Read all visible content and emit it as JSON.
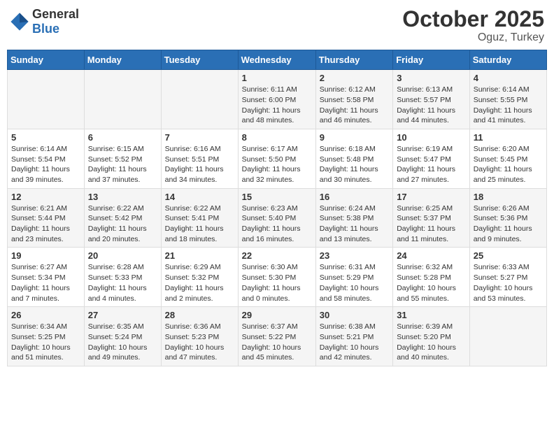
{
  "header": {
    "logo_general": "General",
    "logo_blue": "Blue",
    "month": "October 2025",
    "location": "Oguz, Turkey"
  },
  "days_of_week": [
    "Sunday",
    "Monday",
    "Tuesday",
    "Wednesday",
    "Thursday",
    "Friday",
    "Saturday"
  ],
  "weeks": [
    [
      {
        "day": "",
        "info": ""
      },
      {
        "day": "",
        "info": ""
      },
      {
        "day": "",
        "info": ""
      },
      {
        "day": "1",
        "info": "Sunrise: 6:11 AM\nSunset: 6:00 PM\nDaylight: 11 hours and 48 minutes."
      },
      {
        "day": "2",
        "info": "Sunrise: 6:12 AM\nSunset: 5:58 PM\nDaylight: 11 hours and 46 minutes."
      },
      {
        "day": "3",
        "info": "Sunrise: 6:13 AM\nSunset: 5:57 PM\nDaylight: 11 hours and 44 minutes."
      },
      {
        "day": "4",
        "info": "Sunrise: 6:14 AM\nSunset: 5:55 PM\nDaylight: 11 hours and 41 minutes."
      }
    ],
    [
      {
        "day": "5",
        "info": "Sunrise: 6:14 AM\nSunset: 5:54 PM\nDaylight: 11 hours and 39 minutes."
      },
      {
        "day": "6",
        "info": "Sunrise: 6:15 AM\nSunset: 5:52 PM\nDaylight: 11 hours and 37 minutes."
      },
      {
        "day": "7",
        "info": "Sunrise: 6:16 AM\nSunset: 5:51 PM\nDaylight: 11 hours and 34 minutes."
      },
      {
        "day": "8",
        "info": "Sunrise: 6:17 AM\nSunset: 5:50 PM\nDaylight: 11 hours and 32 minutes."
      },
      {
        "day": "9",
        "info": "Sunrise: 6:18 AM\nSunset: 5:48 PM\nDaylight: 11 hours and 30 minutes."
      },
      {
        "day": "10",
        "info": "Sunrise: 6:19 AM\nSunset: 5:47 PM\nDaylight: 11 hours and 27 minutes."
      },
      {
        "day": "11",
        "info": "Sunrise: 6:20 AM\nSunset: 5:45 PM\nDaylight: 11 hours and 25 minutes."
      }
    ],
    [
      {
        "day": "12",
        "info": "Sunrise: 6:21 AM\nSunset: 5:44 PM\nDaylight: 11 hours and 23 minutes."
      },
      {
        "day": "13",
        "info": "Sunrise: 6:22 AM\nSunset: 5:42 PM\nDaylight: 11 hours and 20 minutes."
      },
      {
        "day": "14",
        "info": "Sunrise: 6:22 AM\nSunset: 5:41 PM\nDaylight: 11 hours and 18 minutes."
      },
      {
        "day": "15",
        "info": "Sunrise: 6:23 AM\nSunset: 5:40 PM\nDaylight: 11 hours and 16 minutes."
      },
      {
        "day": "16",
        "info": "Sunrise: 6:24 AM\nSunset: 5:38 PM\nDaylight: 11 hours and 13 minutes."
      },
      {
        "day": "17",
        "info": "Sunrise: 6:25 AM\nSunset: 5:37 PM\nDaylight: 11 hours and 11 minutes."
      },
      {
        "day": "18",
        "info": "Sunrise: 6:26 AM\nSunset: 5:36 PM\nDaylight: 11 hours and 9 minutes."
      }
    ],
    [
      {
        "day": "19",
        "info": "Sunrise: 6:27 AM\nSunset: 5:34 PM\nDaylight: 11 hours and 7 minutes."
      },
      {
        "day": "20",
        "info": "Sunrise: 6:28 AM\nSunset: 5:33 PM\nDaylight: 11 hours and 4 minutes."
      },
      {
        "day": "21",
        "info": "Sunrise: 6:29 AM\nSunset: 5:32 PM\nDaylight: 11 hours and 2 minutes."
      },
      {
        "day": "22",
        "info": "Sunrise: 6:30 AM\nSunset: 5:30 PM\nDaylight: 11 hours and 0 minutes."
      },
      {
        "day": "23",
        "info": "Sunrise: 6:31 AM\nSunset: 5:29 PM\nDaylight: 10 hours and 58 minutes."
      },
      {
        "day": "24",
        "info": "Sunrise: 6:32 AM\nSunset: 5:28 PM\nDaylight: 10 hours and 55 minutes."
      },
      {
        "day": "25",
        "info": "Sunrise: 6:33 AM\nSunset: 5:27 PM\nDaylight: 10 hours and 53 minutes."
      }
    ],
    [
      {
        "day": "26",
        "info": "Sunrise: 6:34 AM\nSunset: 5:25 PM\nDaylight: 10 hours and 51 minutes."
      },
      {
        "day": "27",
        "info": "Sunrise: 6:35 AM\nSunset: 5:24 PM\nDaylight: 10 hours and 49 minutes."
      },
      {
        "day": "28",
        "info": "Sunrise: 6:36 AM\nSunset: 5:23 PM\nDaylight: 10 hours and 47 minutes."
      },
      {
        "day": "29",
        "info": "Sunrise: 6:37 AM\nSunset: 5:22 PM\nDaylight: 10 hours and 45 minutes."
      },
      {
        "day": "30",
        "info": "Sunrise: 6:38 AM\nSunset: 5:21 PM\nDaylight: 10 hours and 42 minutes."
      },
      {
        "day": "31",
        "info": "Sunrise: 6:39 AM\nSunset: 5:20 PM\nDaylight: 10 hours and 40 minutes."
      },
      {
        "day": "",
        "info": ""
      }
    ]
  ]
}
